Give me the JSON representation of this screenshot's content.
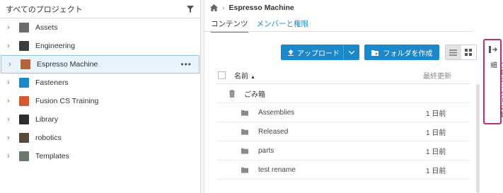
{
  "left_panel": {
    "title": "すべてのプロジェクト",
    "projects": [
      {
        "label": "Assets",
        "icon": "assets-thumb",
        "color": "#6b6b6b"
      },
      {
        "label": "Engineering",
        "icon": "engineering-thumb",
        "color": "#3c3c3c"
      },
      {
        "label": "Espresso Machine",
        "icon": "espresso-thumb",
        "color": "#b5643a",
        "selected": true
      },
      {
        "label": "Fasteners",
        "icon": "fasteners-thumb",
        "color": "#1a88c9"
      },
      {
        "label": "Fusion CS Training",
        "icon": "fusion-thumb",
        "color": "#d8572a"
      },
      {
        "label": "Library",
        "icon": "library-thumb",
        "color": "#2d2d2d"
      },
      {
        "label": "robotics",
        "icon": "robotics-thumb",
        "color": "#5a4a3a"
      },
      {
        "label": "Templates",
        "icon": "templates-thumb",
        "color": "#6a7a6a"
      }
    ],
    "more_label": "•••"
  },
  "breadcrumb": {
    "project": "Espresso Machine"
  },
  "tabs": [
    {
      "label": "コンテンツ",
      "active": true
    },
    {
      "label": "メンバーと権限",
      "active": false
    }
  ],
  "toolbar": {
    "upload_label": "アップロード",
    "create_folder_label": "フォルダを作成"
  },
  "table": {
    "col_name": "名前",
    "col_modified": "最終更新",
    "trash_label": "ごみ箱",
    "rows": [
      {
        "name": "Assemblies",
        "modified": "1 日前"
      },
      {
        "name": "Released",
        "modified": "1 日前"
      },
      {
        "name": "parts",
        "modified": "1 日前"
      },
      {
        "name": "test rename",
        "modified": "1 日前"
      }
    ]
  },
  "side_panel": {
    "label": "プロジェクトの詳細"
  },
  "colors": {
    "accent": "#1a88c9",
    "highlight": "#b0327e"
  }
}
